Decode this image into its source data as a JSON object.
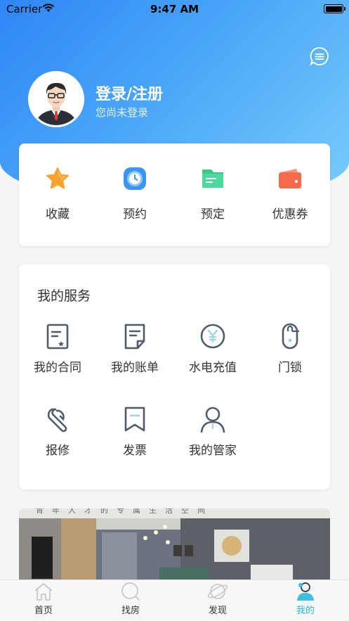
{
  "status_bar": {
    "carrier": "Carrier",
    "time": "9:47 AM"
  },
  "header": {
    "login_title": "登录/注册",
    "login_subtitle": "您尚未登录"
  },
  "quick_actions": [
    {
      "label": "收藏",
      "icon": "star-icon",
      "color": "#f5a32c"
    },
    {
      "label": "预约",
      "icon": "clock-icon",
      "color": "#3a95f0"
    },
    {
      "label": "预定",
      "icon": "folder-icon",
      "color": "#37c98a"
    },
    {
      "label": "优惠券",
      "icon": "wallet-icon",
      "color": "#f56a4b"
    }
  ],
  "services": {
    "title": "我的服务",
    "items": [
      {
        "label": "我的合同",
        "icon": "contract-icon"
      },
      {
        "label": "我的账单",
        "icon": "bill-icon"
      },
      {
        "label": "水电充值",
        "icon": "yuan-coin-icon"
      },
      {
        "label": "门锁",
        "icon": "door-lock-icon"
      },
      {
        "label": "报修",
        "icon": "wrench-icon"
      },
      {
        "label": "发票",
        "icon": "invoice-icon"
      },
      {
        "label": "我的管家",
        "icon": "person-icon"
      }
    ]
  },
  "banner": {
    "caption": "青年人才的专属生活空间"
  },
  "tabbar": {
    "items": [
      {
        "label": "首页",
        "icon": "home-icon"
      },
      {
        "label": "找房",
        "icon": "search-icon"
      },
      {
        "label": "发现",
        "icon": "planet-icon"
      },
      {
        "label": "我的",
        "icon": "profile-icon",
        "active": true
      }
    ],
    "active_color": "#2fb8d9"
  }
}
